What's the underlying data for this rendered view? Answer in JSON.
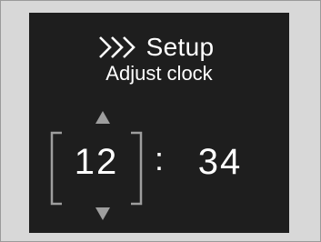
{
  "header": {
    "icon": "triple-chevron-right-icon",
    "title": "Setup"
  },
  "subtitle": "Adjust clock",
  "clock": {
    "hours": "12",
    "separator": ":",
    "minutes": "34",
    "selected_field": "hours"
  },
  "colors": {
    "screen_background": "#1e1e1e",
    "text": "#ffffff",
    "selection_bracket": "#9e9e9e",
    "frame_background": "#d8d8d8"
  }
}
